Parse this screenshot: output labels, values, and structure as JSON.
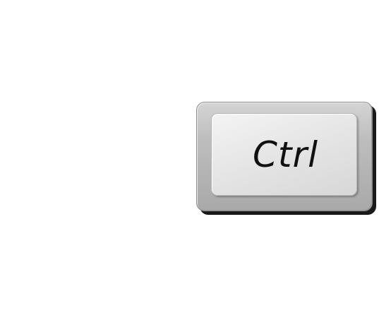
{
  "key": {
    "label": "Ctrl"
  },
  "colors": {
    "background": "#ffffff",
    "key_body": "#bdbdbd",
    "key_face": "#e6e6e6",
    "label": "#111111",
    "shadow": "#1a1a1a"
  }
}
